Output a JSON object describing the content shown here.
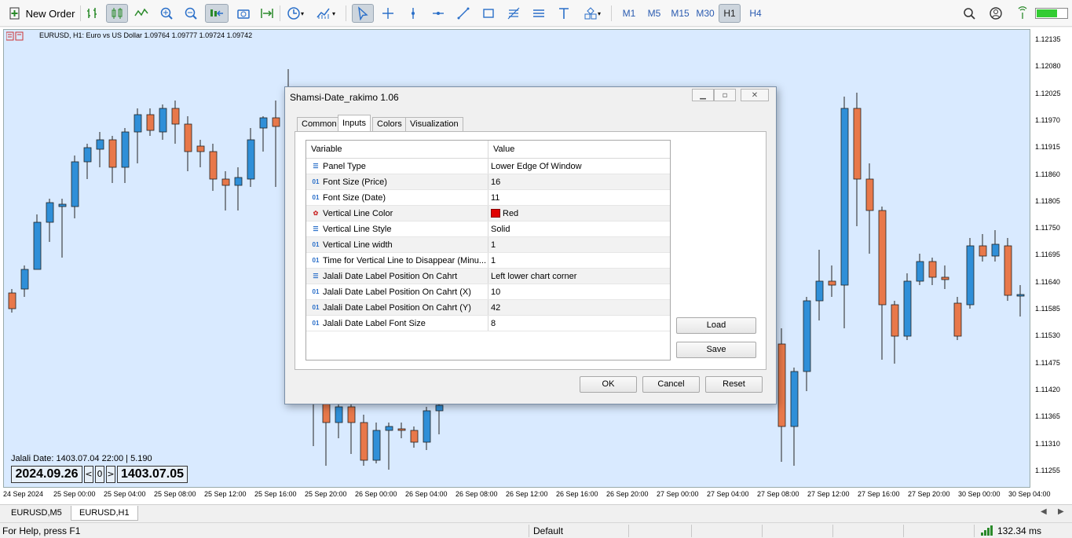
{
  "toolbar": {
    "new_order_label": "New Order",
    "timeframes": [
      "M1",
      "M5",
      "M15",
      "M30",
      "H1",
      "H4"
    ],
    "active_timeframe": "H1"
  },
  "chart": {
    "title": "EURUSD, H1:  Euro vs US Dollar  1.09764 1.09777 1.09724 1.09742",
    "price_labels": [
      "1.12135",
      "1.12080",
      "1.12025",
      "1.11970",
      "1.11915",
      "1.11860",
      "1.11805",
      "1.11750",
      "1.11695",
      "1.11640",
      "1.11585",
      "1.11530",
      "1.11475",
      "1.11420",
      "1.11365",
      "1.11310",
      "1.11255"
    ],
    "time_labels": [
      "24 Sep 2024",
      "25 Sep 00:00",
      "25 Sep 04:00",
      "25 Sep 08:00",
      "25 Sep 12:00",
      "25 Sep 16:00",
      "25 Sep 20:00",
      "26 Sep 00:00",
      "26 Sep 04:00",
      "26 Sep 08:00",
      "26 Sep 12:00",
      "26 Sep 16:00",
      "26 Sep 20:00",
      "27 Sep 00:00",
      "27 Sep 04:00",
      "27 Sep 08:00",
      "27 Sep 12:00",
      "27 Sep 16:00",
      "27 Sep 20:00",
      "30 Sep 00:00",
      "30 Sep 04:00"
    ],
    "up_color": "#2f8fd8",
    "down_color": "#e8784a",
    "background": "#d9eaff"
  },
  "jalali_panel": {
    "info_line": "Jalali Date: 1403.07.04 22:00 | 5.190",
    "gregorian_date": "2024.09.26",
    "prev_label": "<",
    "zero_label": "0",
    "next_label": ">",
    "jalali_date": "1403.07.05"
  },
  "dialog": {
    "title": "Shamsi-Date_rakimo 1.06",
    "tabs": [
      "Common",
      "Inputs",
      "Colors",
      "Visualization"
    ],
    "active_tab": "Inputs",
    "col_variable": "Variable",
    "col_value": "Value",
    "rows": [
      {
        "icon": "enum-icon",
        "variable": "Panel Type",
        "value": "Lower Edge Of Window"
      },
      {
        "icon": "int-icon",
        "variable": "Font Size (Price)",
        "value": "16"
      },
      {
        "icon": "int-icon",
        "variable": "Font Size (Date)",
        "value": "11"
      },
      {
        "icon": "color-icon",
        "variable": "Vertical Line Color",
        "value": "Red"
      },
      {
        "icon": "enum-icon",
        "variable": "Vertical Line Style",
        "value": "Solid"
      },
      {
        "icon": "int-icon",
        "variable": "Vertical Line width",
        "value": "1"
      },
      {
        "icon": "int-icon",
        "variable": "Time for Vertical Line to Disappear (Minu...",
        "value": "1"
      },
      {
        "icon": "enum-icon",
        "variable": "Jalali Date Label Position On Cahrt",
        "value": "Left lower chart corner"
      },
      {
        "icon": "int-icon",
        "variable": "Jalali Date Label Position On Cahrt (X)",
        "value": "10"
      },
      {
        "icon": "int-icon",
        "variable": "Jalali Date Label Position On Cahrt (Y)",
        "value": "42"
      },
      {
        "icon": "int-icon",
        "variable": "Jalali Date Label Font Size",
        "value": "8"
      }
    ],
    "load_label": "Load",
    "save_label": "Save",
    "ok_label": "OK",
    "cancel_label": "Cancel",
    "reset_label": "Reset"
  },
  "symbol_tabs": [
    "EURUSD,M5",
    "EURUSD,H1"
  ],
  "active_symbol_tab": "EURUSD,H1",
  "status_bar": {
    "help_text": "For Help, press F1",
    "profile": "Default",
    "ping": "132.34 ms"
  }
}
